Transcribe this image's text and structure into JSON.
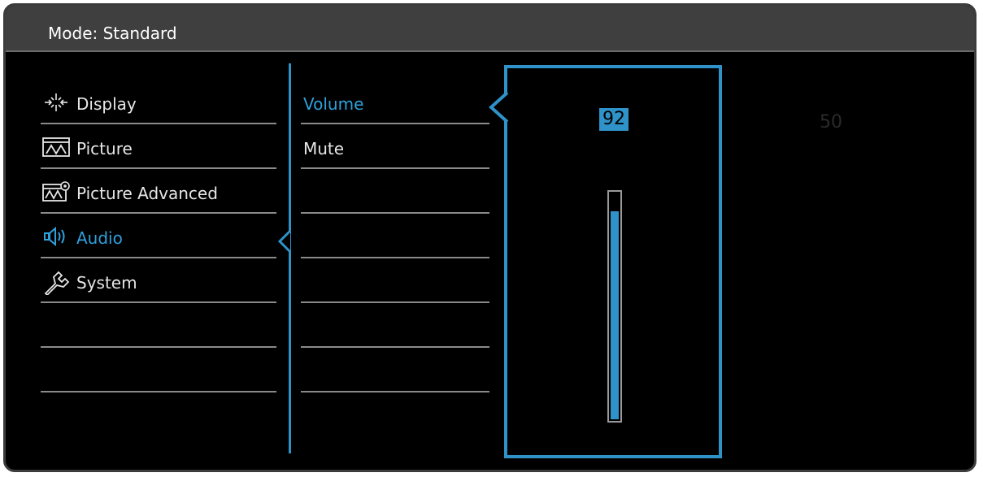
{
  "title": "Mode: Standard",
  "menu": [
    {
      "label": "Display",
      "icon": "display-icon",
      "active": false
    },
    {
      "label": "Picture",
      "icon": "picture-icon",
      "active": false
    },
    {
      "label": "Picture Advanced",
      "icon": "picture-advanced-icon",
      "active": false
    },
    {
      "label": "Audio",
      "icon": "audio-icon",
      "active": true
    },
    {
      "label": "System",
      "icon": "system-wrench-icon",
      "active": false
    }
  ],
  "submenu": [
    {
      "label": "Volume",
      "active": true
    },
    {
      "label": "Mute",
      "active": false
    }
  ],
  "volume": {
    "value": "92",
    "level": 0.92
  },
  "ghost_value": "50",
  "colors": {
    "accent": "#2f92c8",
    "text": "#e6e6e6",
    "titlebar": "#3f3f3f"
  }
}
